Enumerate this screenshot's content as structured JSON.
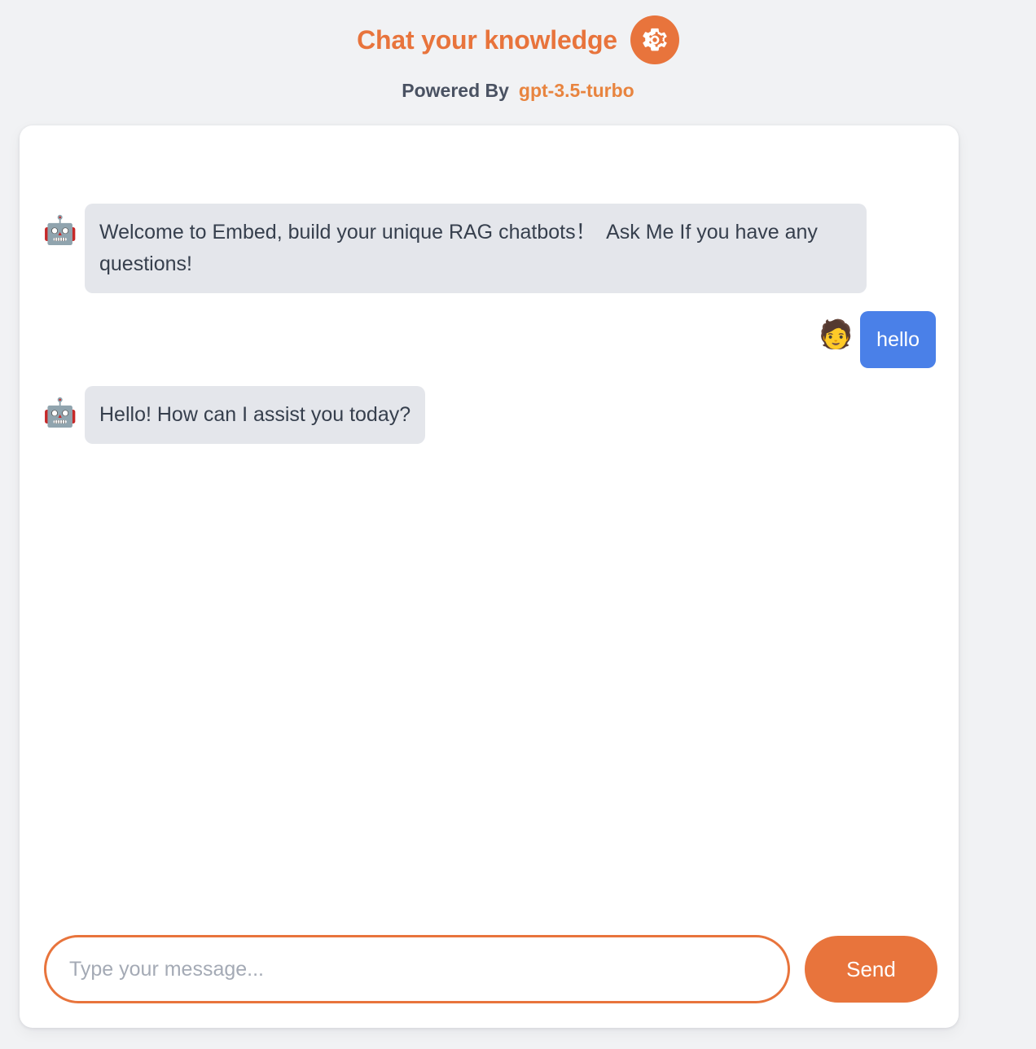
{
  "header": {
    "title": "Chat your knowledge",
    "settings_icon": "gear-icon",
    "powered_by_label": "Powered By",
    "model_name": "gpt-3.5-turbo"
  },
  "theme": {
    "accent": "#e8743c",
    "user_bubble": "#4a80e8",
    "bot_bubble": "#e4e6eb",
    "page_background": "#f1f2f4",
    "card_background": "#ffffff",
    "bot_text": "#363f4d",
    "subtitle_text": "#4a5262"
  },
  "chat": {
    "messages": [
      {
        "role": "bot",
        "avatar": "🤖",
        "avatar_name": "robot-avatar",
        "text": "Welcome to Embed, build your unique RAG chatbots！  Ask Me If you have any questions!"
      },
      {
        "role": "user",
        "avatar": "🧑",
        "avatar_name": "person-avatar",
        "text": "hello"
      },
      {
        "role": "bot",
        "avatar": "🤖",
        "avatar_name": "robot-avatar",
        "text": "Hello! How can I assist you today?"
      }
    ]
  },
  "composer": {
    "input_placeholder": "Type your message...",
    "input_value": "",
    "send_label": "Send"
  }
}
